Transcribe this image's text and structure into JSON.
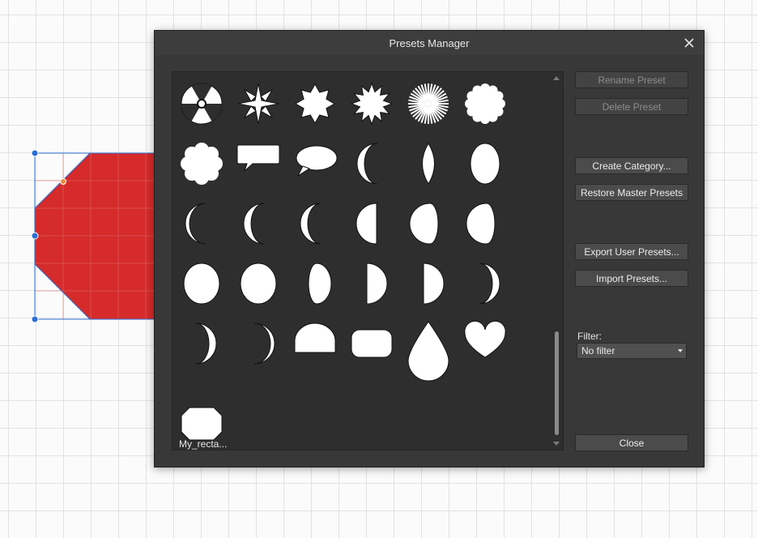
{
  "dialog": {
    "title": "Presets Manager",
    "buttons": {
      "rename": "Rename Preset",
      "delete": "Delete Preset",
      "create_category": "Create Category...",
      "restore": "Restore Master Presets",
      "export": "Export User Presets...",
      "import": "Import Presets...",
      "close": "Close"
    },
    "filter": {
      "label": "Filter:",
      "value": "No filter"
    }
  },
  "presets": {
    "icons": [
      "radiation-icon",
      "four-petal-star-icon",
      "sun-icon",
      "sun-spiky-icon",
      "starburst-icon",
      "scalloped-circle-icon",
      "cloud-icon",
      "speech-bubble-rect-icon",
      "speech-bubble-oval-icon",
      "crescent-icon",
      "vesica-icon",
      "ellipse-icon",
      "crescent-thin-icon",
      "crescent-icon",
      "crescent-icon",
      "half-circle-icon",
      "gibbous-icon",
      "gibbous-icon",
      "circle-icon",
      "circle-icon",
      "gibbous-left-icon",
      "half-circle-right-icon",
      "half-circle-right-icon",
      "crescent-right-icon",
      "crescent-right-icon",
      "crescent-right-thin-icon",
      "dome-icon",
      "rounded-rectangle-icon",
      "teardrop-icon",
      "heart-icon",
      "octagon-icon"
    ],
    "user_preset_label": "My_recta..."
  },
  "colors": {
    "shape_fill": "#d52b2b",
    "selection_handle": "#2b6fd4",
    "dialog_bg": "#383838",
    "panel_bg": "#2e2e2e"
  }
}
